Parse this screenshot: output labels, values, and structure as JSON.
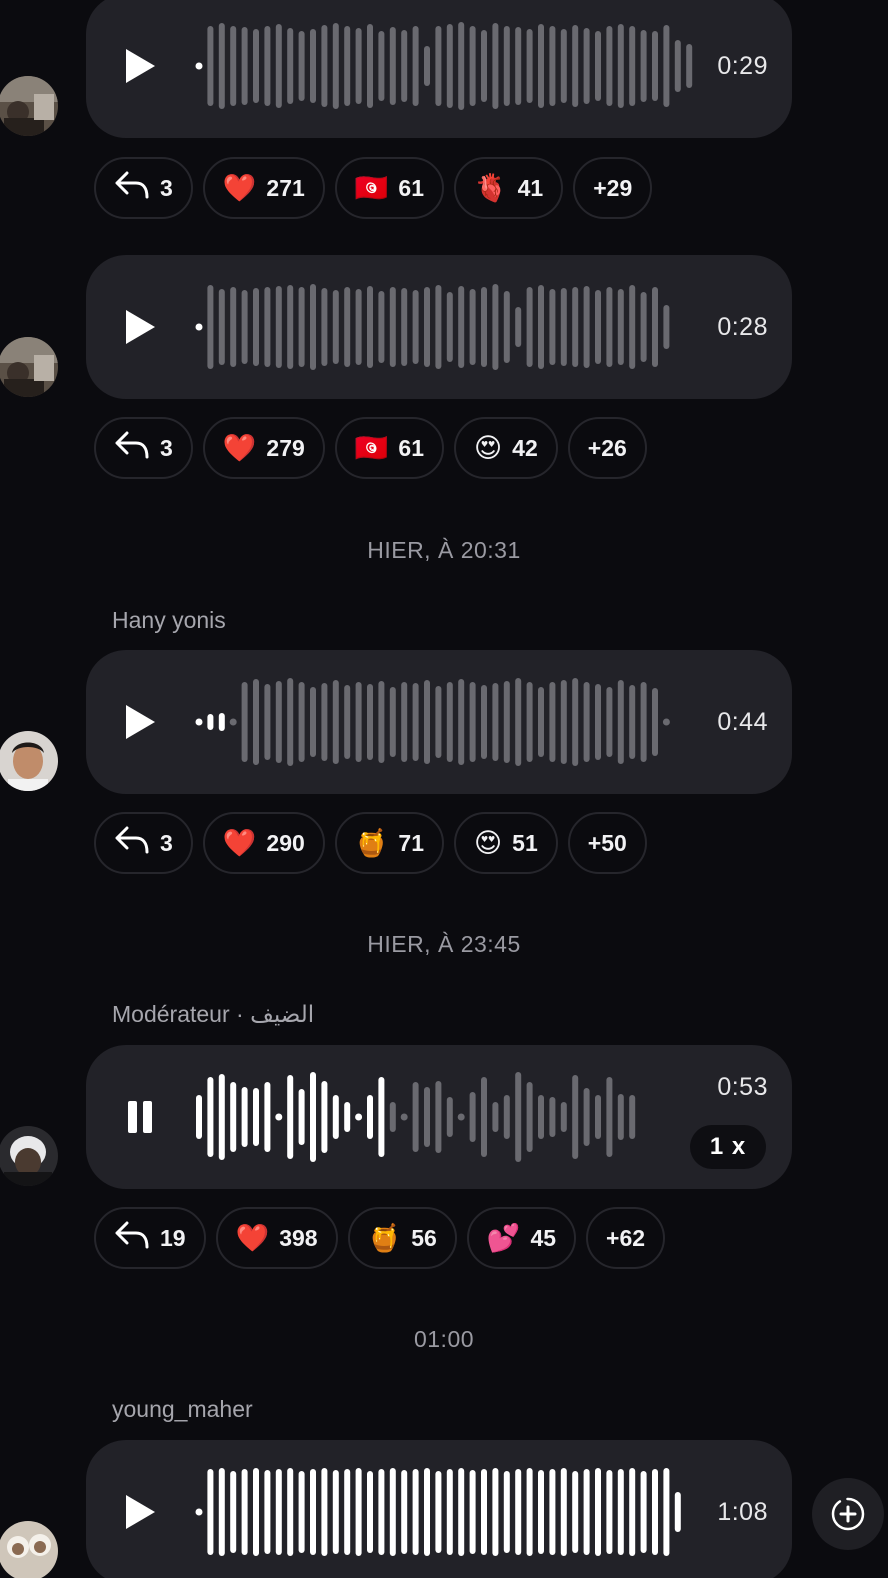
{
  "messages": [
    {
      "duration": "0:29",
      "reactions": {
        "reply": "3",
        "items": [
          {
            "emoji": "❤️",
            "count": "271"
          },
          {
            "emoji": "🇹🇳",
            "count": "61"
          },
          {
            "emoji": "🫀",
            "count": "41"
          }
        ],
        "more": "+29"
      }
    },
    {
      "duration": "0:28",
      "reactions": {
        "reply": "3",
        "items": [
          {
            "emoji": "❤️",
            "count": "279"
          },
          {
            "emoji": "🇹🇳",
            "count": "61"
          },
          {
            "emoji": "😍",
            "count": "42"
          }
        ],
        "more": "+26"
      }
    },
    {
      "date_separator": "HIER, À 20:31",
      "sender": "Hany yonis",
      "duration": "0:44",
      "reactions": {
        "reply": "3",
        "items": [
          {
            "emoji": "❤️",
            "count": "290"
          },
          {
            "emoji": "🍯",
            "count": "71"
          },
          {
            "emoji": "😍",
            "count": "51"
          }
        ],
        "more": "+50"
      }
    },
    {
      "date_separator": "HIER, À 23:45",
      "sender": "Modérateur · الضيف",
      "duration": "0:53",
      "playback_speed": "1 x",
      "reactions": {
        "reply": "19",
        "items": [
          {
            "emoji": "❤️",
            "count": "398"
          },
          {
            "emoji": "🍯",
            "count": "56"
          },
          {
            "emoji": "💕",
            "count": "45"
          }
        ],
        "more": "+62"
      }
    },
    {
      "date_separator": "01:00",
      "sender": "young_maher",
      "duration": "1:08"
    }
  ],
  "icons": {
    "play": "play-icon",
    "pause": "pause-icon",
    "reply": "reply-arrow-icon",
    "add": "add-circle-icon"
  },
  "colors": {
    "background": "#0b0b0f",
    "bubble": "#222228",
    "played": "#ffffff",
    "unplayed": "#6a6a70"
  }
}
